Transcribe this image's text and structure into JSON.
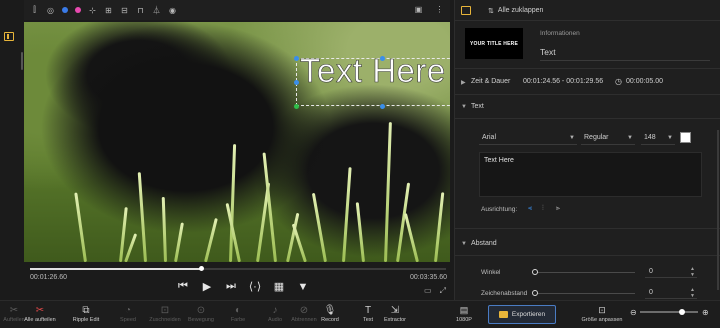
{
  "preview_toolbar": {
    "left_icons": [
      "grid-icon",
      "circle-icon",
      "dot-blue-icon",
      "dot-pink-icon",
      "crop-icon",
      "mask-icon",
      "layers-icon",
      "lock-icon",
      "brush-icon",
      "eye-icon"
    ],
    "dot_colors": [
      "#3ab0e8",
      "#3a7be8",
      "#e84ab0"
    ],
    "right_icons": [
      "camera-icon",
      "settings-icon"
    ]
  },
  "preview": {
    "overlay_text": "Text Here",
    "current_time": "00:01:26.60",
    "total_time": "00:03:35.60",
    "progress": 0.41
  },
  "panel": {
    "collapse_label": "Alle zuklappen",
    "thumbnail_text": "YOUR TITLE HERE",
    "info_label": "Informationen",
    "clip_name": "Text",
    "time_section": {
      "title": "Zeit & Dauer",
      "range": "00:01:24.56 - 00:01:29.56",
      "duration": "00:00:05.00"
    },
    "text_section": {
      "title": "Text",
      "font": "Arial",
      "style": "Regular",
      "size": "148",
      "content": "Text Here",
      "alignment_label": "Ausrichtung:"
    },
    "spacing_section": {
      "title": "Abstand",
      "angle_label": "Winkel",
      "angle_value": "0",
      "char_spacing_label": "Zeichenabstand",
      "char_spacing_value": "0"
    }
  },
  "bottom_bar": {
    "tools": [
      {
        "label": "Aufteilen",
        "icon": "scissors-icon",
        "dim": true
      },
      {
        "label": "Alle aufteilen",
        "icon": "scissors-red-icon",
        "dim": false
      },
      {
        "label": "Ripple Edit",
        "icon": "ripple-icon",
        "dim": false
      },
      {
        "label": "Speed",
        "icon": "speed-icon",
        "dim": true
      },
      {
        "label": "Zuschneiden",
        "icon": "crop-icon",
        "dim": true
      },
      {
        "label": "Bewegung",
        "icon": "motion-icon",
        "dim": true
      },
      {
        "label": "Farbe",
        "icon": "color-icon",
        "dim": true
      },
      {
        "label": "Audio",
        "icon": "audio-icon",
        "dim": true
      },
      {
        "label": "Abtrennen",
        "icon": "detach-icon",
        "dim": true
      },
      {
        "label": "Record",
        "icon": "mic-icon",
        "dim": false
      },
      {
        "label": "Text",
        "icon": "text-icon",
        "dim": false
      },
      {
        "label": "Extractor",
        "icon": "extractor-icon",
        "dim": false
      }
    ],
    "resolution": "1080P",
    "export_label": "Exportieren",
    "fit_label": "Größe anpassen",
    "zoom_level": 0.72
  }
}
